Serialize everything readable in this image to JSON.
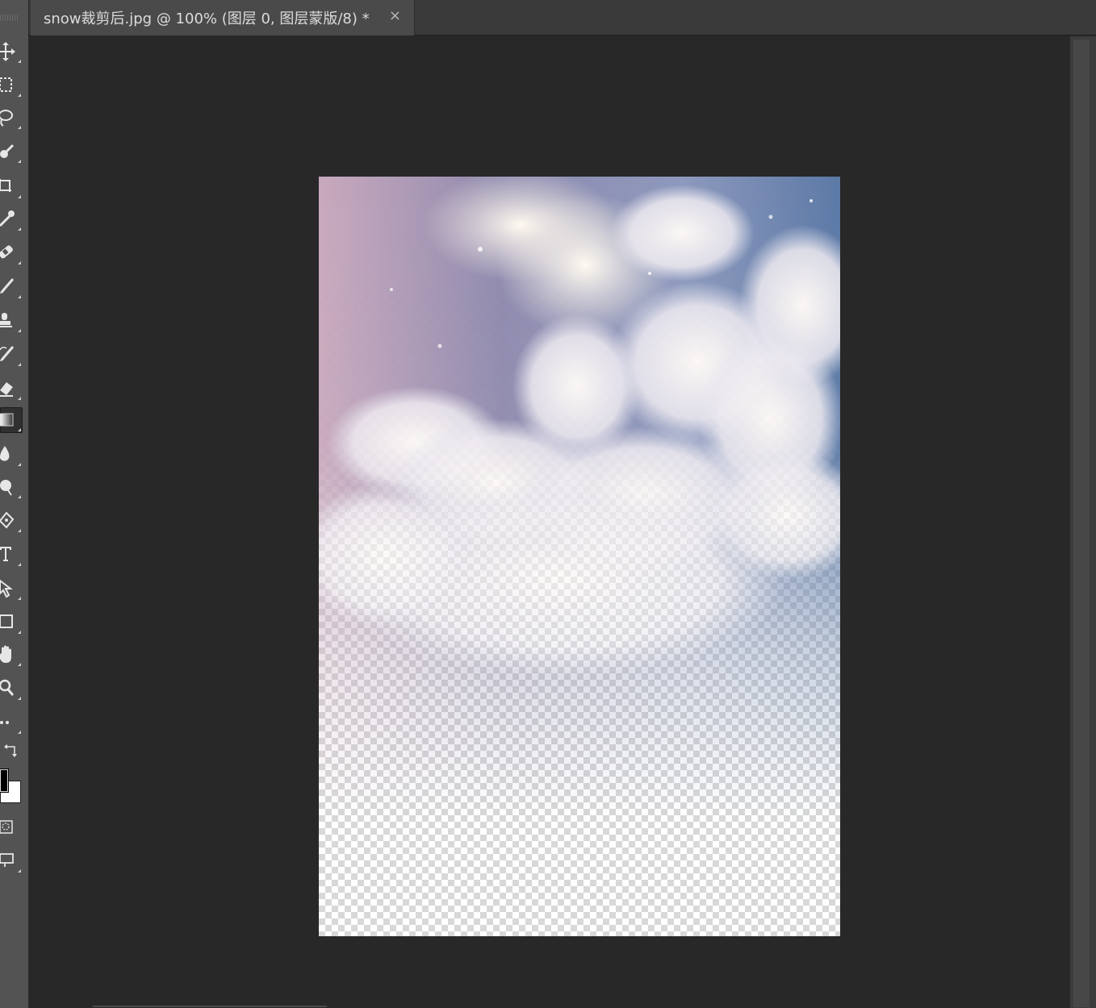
{
  "document_tab": {
    "title": "snow裁剪后.jpg @ 100% (图层 0, 图层蒙版/8) *",
    "close_glyph": "×"
  },
  "toolbar": {
    "tools": [
      {
        "name": "move-tool",
        "icon": "move-icon"
      },
      {
        "name": "rectangular-marquee-tool",
        "icon": "marquee-icon"
      },
      {
        "name": "lasso-tool",
        "icon": "lasso-icon"
      },
      {
        "name": "quick-selection-tool",
        "icon": "quick-selection-icon"
      },
      {
        "name": "crop-tool",
        "icon": "crop-icon"
      },
      {
        "name": "eyedropper-tool",
        "icon": "eyedropper-icon"
      },
      {
        "name": "healing-brush-tool",
        "icon": "bandage-icon"
      },
      {
        "name": "brush-tool",
        "icon": "brush-icon"
      },
      {
        "name": "clone-stamp-tool",
        "icon": "stamp-icon"
      },
      {
        "name": "history-brush-tool",
        "icon": "history-brush-icon"
      },
      {
        "name": "eraser-tool",
        "icon": "eraser-icon"
      },
      {
        "name": "gradient-tool",
        "icon": "gradient-icon",
        "active": true
      },
      {
        "name": "blur-tool",
        "icon": "drop-icon"
      },
      {
        "name": "dodge-tool",
        "icon": "dodge-icon"
      },
      {
        "name": "pen-tool",
        "icon": "pen-icon"
      },
      {
        "name": "type-tool",
        "icon": "type-icon"
      },
      {
        "name": "path-selection-tool",
        "icon": "arrow-icon"
      },
      {
        "name": "rectangle-tool",
        "icon": "rectangle-icon"
      },
      {
        "name": "hand-tool",
        "icon": "hand-icon"
      },
      {
        "name": "zoom-tool",
        "icon": "zoom-icon"
      },
      {
        "name": "edit-toolbar",
        "icon": "more-icon"
      }
    ],
    "bottom": [
      {
        "name": "swap-colors",
        "icon": "swap-icon"
      },
      {
        "name": "quick-mask-mode",
        "icon": "quick-mask-icon"
      },
      {
        "name": "screen-mode",
        "icon": "screen-mode-icon"
      }
    ],
    "foreground_color": "#000000",
    "background_color": "#ffffff"
  },
  "canvas": {
    "background": "#282828",
    "zoom": "100%"
  }
}
